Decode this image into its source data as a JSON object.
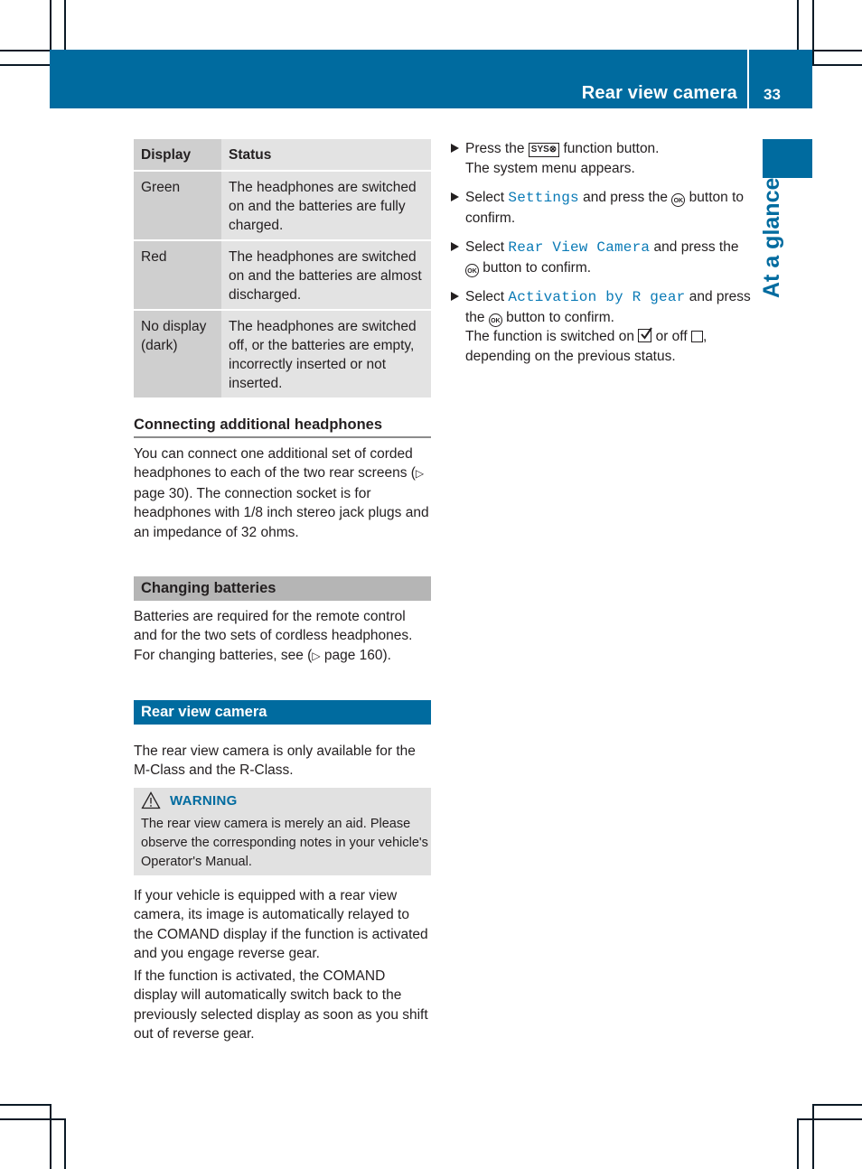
{
  "header": {
    "section_title": "Rear view camera",
    "page_number": "33",
    "brand_color": "#006b9f"
  },
  "side_tab": {
    "label": "At a glance"
  },
  "status_table": {
    "columns": [
      "Display",
      "Status"
    ],
    "rows": [
      {
        "display": "Green",
        "status": "The headphones are switched on and the batteries are fully charged."
      },
      {
        "display": "Red",
        "status": "The headphones are switched on and the batteries are almost discharged."
      },
      {
        "display": "No display (dark)",
        "status": "The headphones are switched off, or the batteries are empty, incorrectly inserted or not inserted."
      }
    ]
  },
  "connecting": {
    "heading": "Connecting additional headphones",
    "body_1": "You can connect one additional set of corded headphones to each of the two rear screens (",
    "ref_icon": "▷",
    "ref_page": " page 30",
    "body_2": "). The connection socket is for headphones with 1/8 inch stereo jack plugs and an impedance of 32 ohms."
  },
  "changing_batteries": {
    "heading": "Changing batteries",
    "body_1": "Batteries are required for the remote control and for the two sets of cordless headphones. For changing batteries, see (",
    "ref_icon": "▷",
    "ref_page": " page 160",
    "body_2": ")."
  },
  "rear_view_camera": {
    "heading": "Rear view camera",
    "intro": "The rear view camera is only available for the M-Class and the R-Class.",
    "warning": {
      "icon": "warning-triangle-icon",
      "label": "WARNING",
      "text": "The rear view camera is merely an aid. Please observe the corresponding notes in your vehicle's Operator's Manual."
    },
    "para_1": "If your vehicle is equipped with a rear view camera, its image is automatically relayed to the COMAND display if the function is activated and you engage reverse gear.",
    "para_2": "If the function is activated, the COMAND display will automatically switch back to the previously selected display as soon as you shift out of reverse gear."
  },
  "steps": [
    {
      "pre": "Press the ",
      "button": "SYS",
      "post": " function button.",
      "result": "The system menu appears."
    },
    {
      "pre": "Select ",
      "menu": "Settings",
      "mid": " and press the ",
      "ok": "OK",
      "post": " button to confirm."
    },
    {
      "pre": "Select ",
      "menu": "Rear View Camera",
      "mid": " and press the ",
      "ok": "OK",
      "post": " button to confirm."
    },
    {
      "pre": "Select ",
      "menu": "Activation by R gear",
      "mid": " and press the ",
      "ok": "OK",
      "post": " button to confirm.",
      "result_1": "The function is switched on ",
      "result_2": " or off ",
      "result_3": ", depending on the previous status."
    }
  ]
}
